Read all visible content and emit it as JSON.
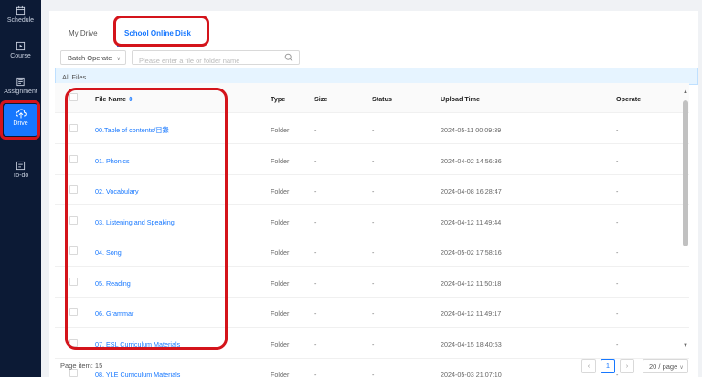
{
  "sidebar": {
    "items": [
      {
        "label": "Schedule"
      },
      {
        "label": "Course"
      },
      {
        "label": "Assignment"
      },
      {
        "label": "Drive",
        "active": true
      },
      {
        "label": "To-do"
      }
    ]
  },
  "tabs": [
    {
      "label": "My Drive"
    },
    {
      "label": "School Online Disk",
      "active": true
    }
  ],
  "toolbar": {
    "batch_label": "Batch Operate",
    "search_placeholder": "Please enter a file or folder name"
  },
  "breadcrumb": "All Files",
  "table": {
    "columns": [
      "File Name",
      "Type",
      "Size",
      "Status",
      "Upload Time",
      "Operate"
    ],
    "rows": [
      {
        "name": "00.Table of contents/目錄",
        "type": "Folder",
        "size": "-",
        "status": "-",
        "time": "2024-05-11 00:09:39",
        "operate": "-"
      },
      {
        "name": "01. Phonics",
        "type": "Folder",
        "size": "-",
        "status": "-",
        "time": "2024-04-02 14:56:36",
        "operate": "-"
      },
      {
        "name": "02. Vocabulary",
        "type": "Folder",
        "size": "-",
        "status": "-",
        "time": "2024-04-08 16:28:47",
        "operate": "-"
      },
      {
        "name": "03. Listening and Speaking",
        "type": "Folder",
        "size": "-",
        "status": "-",
        "time": "2024-04-12 11:49:44",
        "operate": "-"
      },
      {
        "name": "04. Song",
        "type": "Folder",
        "size": "-",
        "status": "-",
        "time": "2024-05-02 17:58:16",
        "operate": "-"
      },
      {
        "name": "05. Reading",
        "type": "Folder",
        "size": "-",
        "status": "-",
        "time": "2024-04-12 11:50:18",
        "operate": "-"
      },
      {
        "name": "06. Grammar",
        "type": "Folder",
        "size": "-",
        "status": "-",
        "time": "2024-04-12 11:49:17",
        "operate": "-"
      },
      {
        "name": "07. ESL Curriculum Materials",
        "type": "Folder",
        "size": "-",
        "status": "-",
        "time": "2024-04-15 18:40:53",
        "operate": "-"
      },
      {
        "name": "08. YLE Curriculum Materials",
        "type": "Folder",
        "size": "-",
        "status": "-",
        "time": "2024-05-03 21:07:10",
        "operate": "-"
      }
    ]
  },
  "footer": {
    "page_item": "Page item: 15",
    "current_page": "1",
    "page_size": "20 / page"
  },
  "colors": {
    "sidebar": "#0c1a35",
    "accent": "#1677ff",
    "highlight": "#d4141b"
  }
}
